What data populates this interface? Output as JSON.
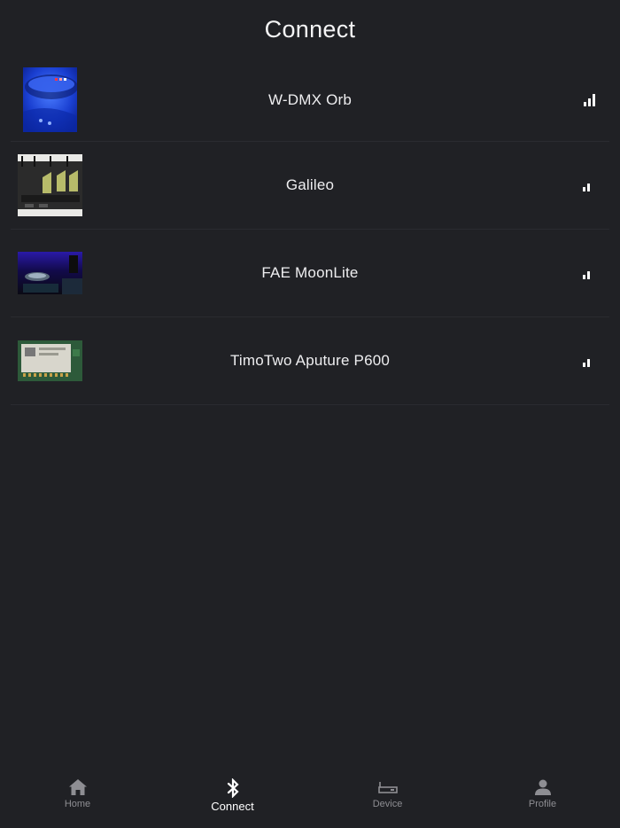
{
  "header": {
    "title": "Connect"
  },
  "devices": [
    {
      "name": "W-DMX Orb",
      "signal_bars": 3
    },
    {
      "name": "Galileo",
      "signal_bars": 2
    },
    {
      "name": "FAE MoonLite",
      "signal_bars": 2
    },
    {
      "name": "TimoTwo Aputure P600",
      "signal_bars": 2
    }
  ],
  "tabs": [
    {
      "label": "Home",
      "icon": "home-icon",
      "active": false
    },
    {
      "label": "Connect",
      "icon": "bluetooth-icon",
      "active": true
    },
    {
      "label": "Device",
      "icon": "device-icon",
      "active": false
    },
    {
      "label": "Profile",
      "icon": "profile-icon",
      "active": false
    }
  ],
  "colors": {
    "background": "#202125",
    "text": "#ffffff",
    "inactive_tab": "#8e8e93"
  }
}
